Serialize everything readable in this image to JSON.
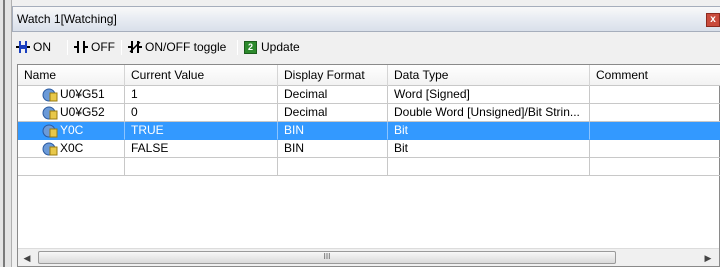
{
  "window": {
    "title": "Watch 1[Watching]",
    "close_label": "x"
  },
  "toolbar": {
    "on_label": "ON",
    "off_label": "OFF",
    "toggle_label": "ON/OFF toggle",
    "update_label": "Update"
  },
  "table": {
    "columns": [
      "Name",
      "Current Value",
      "Display Format",
      "Data Type",
      "Comment"
    ],
    "rows": [
      {
        "name": "U0¥G51",
        "value": "1",
        "format": "Decimal",
        "type": "Word [Signed]",
        "comment": ""
      },
      {
        "name": "U0¥G52",
        "value": "0",
        "format": "Decimal",
        "type": "Double Word [Unsigned]/Bit Strin...",
        "comment": ""
      },
      {
        "name": "Y0C",
        "value": "TRUE",
        "format": "BIN",
        "type": "Bit",
        "comment": ""
      },
      {
        "name": "X0C",
        "value": "FALSE",
        "format": "BIN",
        "type": "Bit",
        "comment": ""
      },
      {
        "name": "",
        "value": "",
        "format": "",
        "type": "",
        "comment": ""
      }
    ],
    "selected_row": 2
  },
  "scrollbar": {
    "thumb_label": "III"
  },
  "colors": {
    "selection": "#3399ff",
    "close_button": "#c94b3c"
  }
}
